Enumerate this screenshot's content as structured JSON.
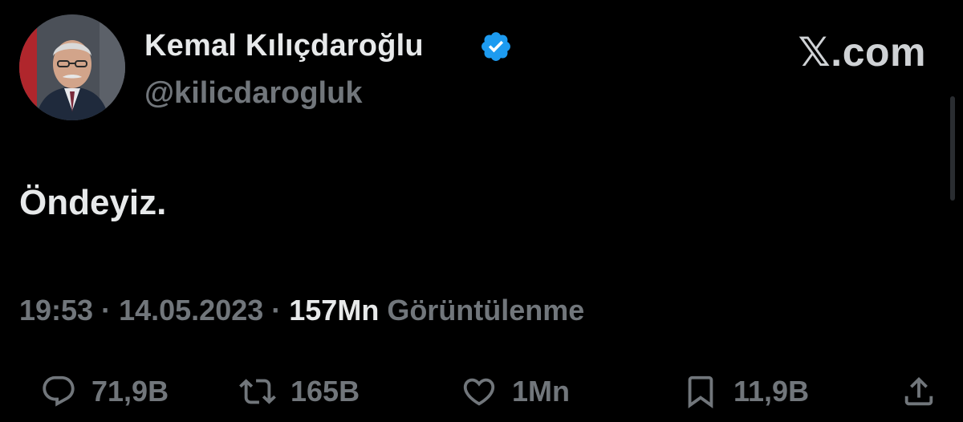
{
  "author": {
    "display_name": "Kemal Kılıçdaroğlu",
    "handle": "@kilicdarogluk",
    "verified_icon": "verified-badge-icon",
    "verified_color": "#1d9bf0"
  },
  "brand": "𝕏.com",
  "tweet": {
    "text": "Öndeyiz."
  },
  "meta": {
    "time": "19:53",
    "sep1": " · ",
    "date": "14.05.2023",
    "sep2": " · ",
    "views_count": "157Mn",
    "views_label": " Görüntülenme"
  },
  "actions": {
    "reply": {
      "icon": "reply-icon",
      "count": "71,9B"
    },
    "retweet": {
      "icon": "retweet-icon",
      "count": "165B"
    },
    "like": {
      "icon": "heart-icon",
      "count": "1Mn"
    },
    "bookmark": {
      "icon": "bookmark-icon",
      "count": "11,9B"
    },
    "share": {
      "icon": "share-icon"
    }
  },
  "colors": {
    "background": "#000000",
    "primary_text": "#e7e9ea",
    "secondary_text": "#71767b"
  }
}
